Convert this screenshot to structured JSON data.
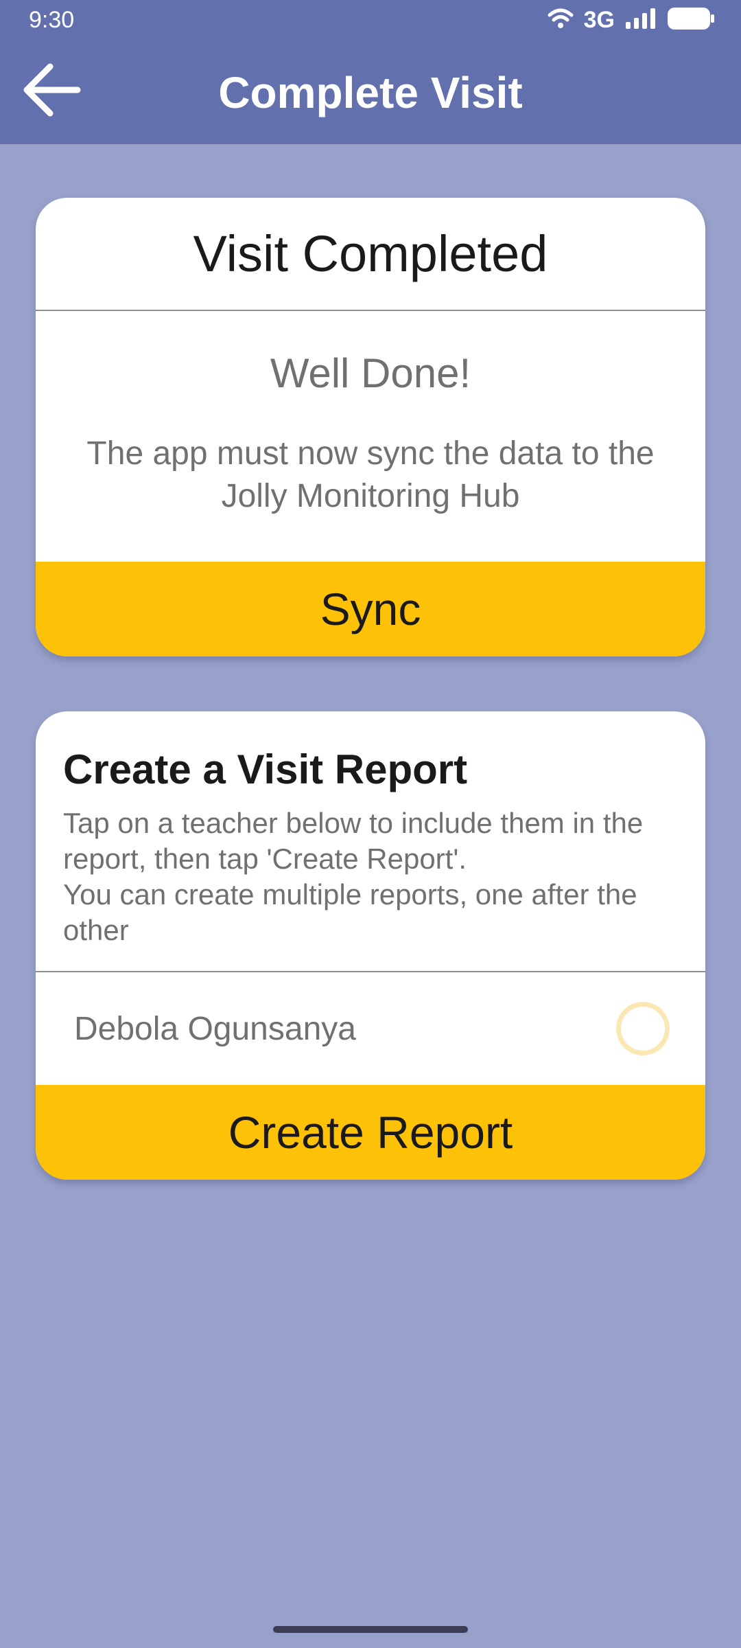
{
  "status_bar": {
    "time": "9:30",
    "network": "3G",
    "icons": [
      "wifi-icon",
      "signal-icon",
      "battery-icon"
    ]
  },
  "app_bar": {
    "title": "Complete Visit",
    "back_icon": "arrow-left-icon"
  },
  "sync_card": {
    "title": "Visit Completed",
    "subtitle": "Well Done!",
    "description": "The app must now sync the data to the Jolly Monitoring Hub",
    "button_label": "Sync"
  },
  "report_card": {
    "title": "Create a Visit Report",
    "description_line1": "Tap on a teacher below to include them in the report, then tap 'Create Report'.",
    "description_line2": "You can create multiple reports, one after the other",
    "teachers": [
      {
        "name": "Debola Ogunsanya",
        "selected": false
      }
    ],
    "button_label": "Create Report"
  },
  "colors": {
    "app_bar": "#6270ae",
    "background": "#98a1c9",
    "accent": "#fdc107",
    "radio_ring": "#fbe7b4"
  }
}
